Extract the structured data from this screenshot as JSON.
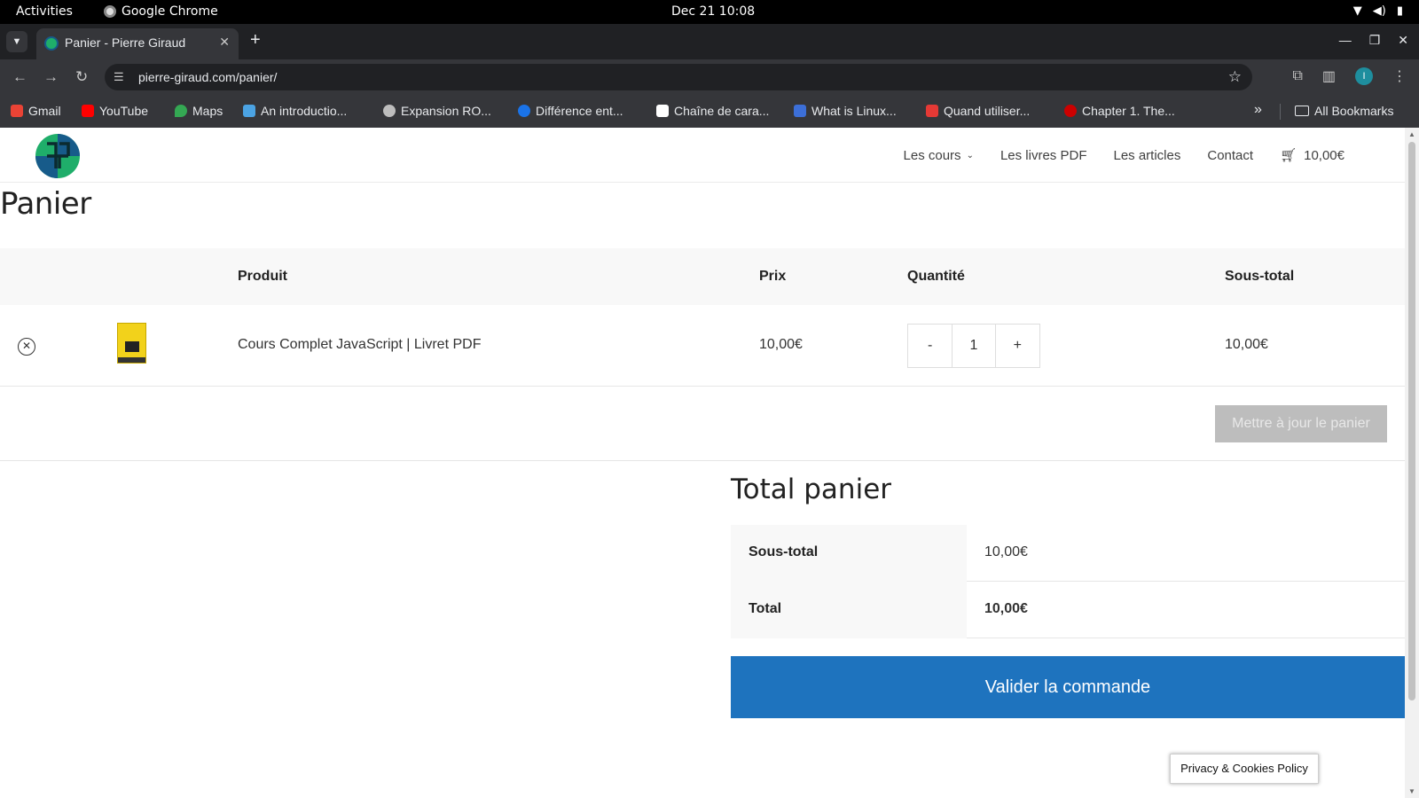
{
  "os": {
    "activities": "Activities",
    "app_name": "Google Chrome",
    "clock": "Dec 21  10:08"
  },
  "browser": {
    "tab_title": "Panier - Pierre Giraud",
    "url": "pierre-giraud.com/panier/",
    "bookmarks": [
      {
        "label": "Gmail",
        "icon": "gmail-icon",
        "color": "#ea4335"
      },
      {
        "label": "YouTube",
        "icon": "youtube-icon",
        "color": "#ff0000"
      },
      {
        "label": "Maps",
        "icon": "maps-icon",
        "color": "#34a853"
      },
      {
        "label": "An introductio...",
        "icon": "gear-icon",
        "color": "#4ba3e3"
      },
      {
        "label": "Expansion RO...",
        "icon": "globe-icon",
        "color": "#bdbdbd"
      },
      {
        "label": "Différence ent...",
        "icon": "vs-icon",
        "color": "#1a73e8"
      },
      {
        "label": "Chaîne de cara...",
        "icon": "wikipedia-icon",
        "color": "#ffffff"
      },
      {
        "label": "What is Linux...",
        "icon": "g-icon",
        "color": "#3c6fd8"
      },
      {
        "label": "Quand utiliser...",
        "icon": "qa-icon",
        "color": "#e53935"
      },
      {
        "label": "Chapter 1. The...",
        "icon": "redhat-icon",
        "color": "#cc0000"
      }
    ],
    "all_bookmarks": "All Bookmarks"
  },
  "site": {
    "nav": {
      "courses": "Les cours",
      "books": "Les livres PDF",
      "articles": "Les articles",
      "contact": "Contact",
      "cart_total": "10,00€"
    },
    "page_title": "Panier",
    "table": {
      "headers": {
        "product": "Produit",
        "price": "Prix",
        "quantity": "Quantité",
        "subtotal": "Sous-total"
      },
      "rows": [
        {
          "name": "Cours Complet JavaScript | Livret PDF",
          "price": "10,00€",
          "quantity": "1",
          "subtotal": "10,00€"
        }
      ],
      "minus": "-",
      "plus": "+"
    },
    "update_button": "Mettre à jour le panier",
    "totals": {
      "title": "Total panier",
      "subtotal_label": "Sous-total",
      "subtotal_value": "10,00€",
      "total_label": "Total",
      "total_value": "10,00€"
    },
    "checkout_button": "Valider la commande",
    "privacy": "Privacy & Cookies Policy"
  },
  "colors": {
    "accent": "#1e73be",
    "brand_green": "#1fae6a",
    "brand_blue": "#175b8a"
  }
}
